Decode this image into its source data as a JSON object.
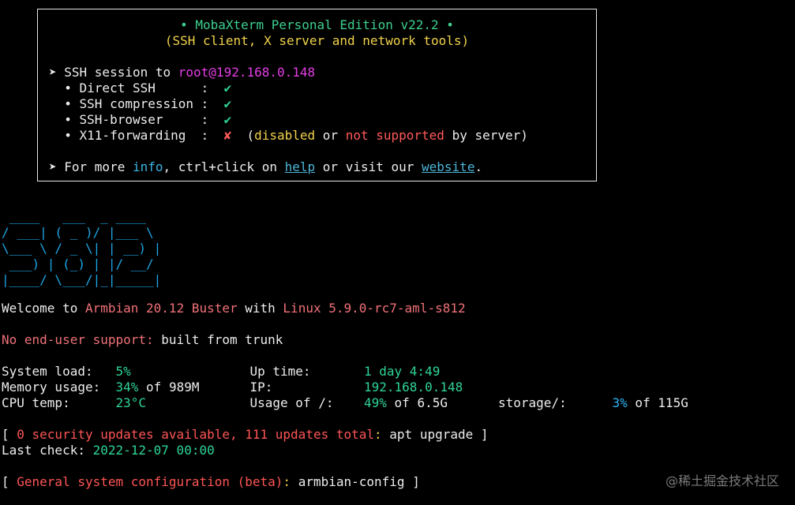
{
  "banner": {
    "title": "• MobaXterm Personal Edition v22.2 •",
    "subtitle": "(SSH client, X server and network tools)",
    "session_prefix": "➤ SSH session to ",
    "session_host": "root@192.168.0.148",
    "features": [
      {
        "label": "  • Direct SSH      :  ",
        "mark": "✔"
      },
      {
        "label": "  • SSH compression :  ",
        "mark": "✔"
      },
      {
        "label": "  • SSH-browser     :  ",
        "mark": "✔"
      },
      {
        "label": "  • X11-forwarding  :  ",
        "mark": "✘"
      }
    ],
    "x11_note_open": "  (",
    "x11_disabled": "disabled",
    "x11_or": " or ",
    "x11_not_supported": "not supported",
    "x11_close": " by server)",
    "more_prefix": "➤ For more ",
    "more_info": "info",
    "more_mid": ", ctrl+click on ",
    "more_help": "help",
    "more_mid2": " or visit our ",
    "more_website": "website",
    "more_end": "."
  },
  "ascii_art": " ____   ___  _ ____\n/ ___| ( _ )/ |___ \\\n\\___ \\ / _ \\| | __) |\n ___) | (_) | |/ __/\n|____/ \\___/|_|_____|",
  "welcome": {
    "prefix": "Welcome to ",
    "distro": "Armbian 20.12 Buster",
    "mid": " with ",
    "kernel": "Linux 5.9.0-rc7-aml-s812"
  },
  "support": {
    "label": "No end-user support:",
    "value": " built from trunk"
  },
  "stats": {
    "row1": {
      "l1": "System load:   ",
      "v1": "5%",
      "l2": "Up time:       ",
      "v2": "1 day 4:49"
    },
    "row2": {
      "l1": "Memory usage:  ",
      "v1": "34%",
      "v1b": " of 989M",
      "l2": "IP:            ",
      "v2": "192.168.0.148"
    },
    "row3": {
      "l1": "CPU temp:      ",
      "v1": "23°C",
      "l2": "Usage of /:    ",
      "v2": "49%",
      "v2b": " of 6.5G",
      "l3": "storage/:      ",
      "v3": "3%",
      "v3b": " of 115G"
    }
  },
  "updates": {
    "open": "[ ",
    "text": "0 security updates available, 111 updates total",
    "colon": ":",
    "cmd": " apt upgrade ]"
  },
  "last_check": {
    "label": "Last check: ",
    "value": "2022-12-07 00:00"
  },
  "config": {
    "open": "[ ",
    "text": "General system configuration (beta)",
    "colon": ":",
    "cmd": " armbian-config ]"
  },
  "watermark": "@稀土掘金技术社区"
}
